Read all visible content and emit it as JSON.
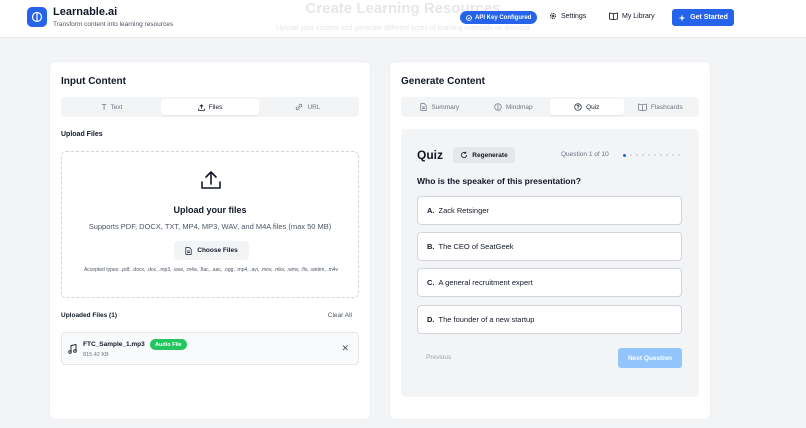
{
  "header": {
    "brand": "Learnable.ai",
    "tagline": "Transform content into learning resources",
    "page_title": "Create Learning Resources",
    "page_subtitle": "Upload your content and generate different types of learning materials on demand",
    "api_badge": "API Key Configured",
    "settings_label": "Settings",
    "library_label": "My Library",
    "get_started_label": "Get Started",
    "colors": {
      "primary": "#2563eb",
      "success": "#22c55e",
      "disabled": "#93c5fd"
    }
  },
  "input": {
    "title": "Input Content",
    "tabs": [
      {
        "label": "Text",
        "icon": "text-icon"
      },
      {
        "label": "Files",
        "icon": "upload-icon",
        "active": true
      },
      {
        "label": "URL",
        "icon": "link-icon"
      }
    ],
    "upload_label": "Upload Files",
    "dropzone": {
      "title": "Upload your files",
      "subtitle": "Supports PDF, DOCX, TXT, MP4, MP3, WAV, and M4A files (max 50 MB)",
      "choose_label": "Choose Files",
      "accepted": "Accepted types: .pdf, .docx, .doc, .mp3, .wav, .m4a, .flac, .aac, .ogg, .mp4, .avi, .mov, .mkv, .wmv, .flv, .webm, .m4v"
    },
    "uploaded_label": "Uploaded Files (1)",
    "clear_all": "Clear All",
    "files": [
      {
        "name": "FTC_Sample_1.mp3",
        "badge": "Audio File",
        "size": "815.42 KB"
      }
    ]
  },
  "generate": {
    "title": "Generate Content",
    "tabs": [
      {
        "label": "Summary",
        "icon": "document-icon"
      },
      {
        "label": "Mindmap",
        "icon": "mindmap-icon"
      },
      {
        "label": "Quiz",
        "icon": "help-circle-icon",
        "active": true
      },
      {
        "label": "Flashcards",
        "icon": "book-icon"
      }
    ],
    "quiz": {
      "title": "Quiz",
      "regenerate_label": "Regenerate",
      "counter": "Question 1 of 10",
      "current": 1,
      "total": 10,
      "question": "Who is the speaker of this presentation?",
      "options": [
        {
          "letter": "A.",
          "text": "Zack Retsinger"
        },
        {
          "letter": "B.",
          "text": "The CEO of SeatGeek"
        },
        {
          "letter": "C.",
          "text": "A general recruitment expert"
        },
        {
          "letter": "D.",
          "text": "The founder of a new startup"
        }
      ],
      "previous_label": "Previous",
      "next_label": "Next Question"
    }
  }
}
